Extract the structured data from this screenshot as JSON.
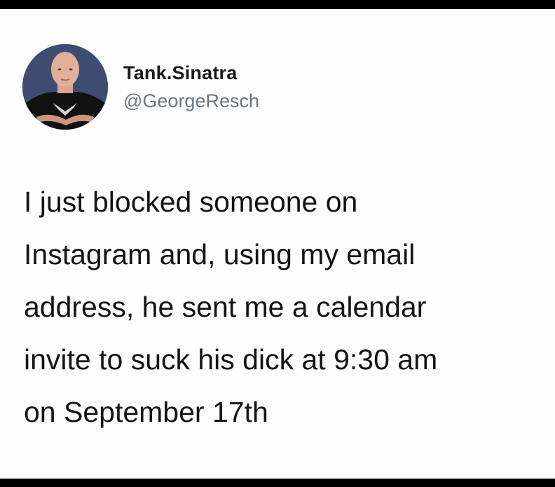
{
  "tweet": {
    "author": {
      "display_name": "Tank.Sinatra",
      "handle": "@GeorgeResch",
      "avatar_icon": "profile-photo"
    },
    "text_lines": [
      "I just blocked someone on",
      "Instagram and, using my email",
      "address, he sent me a calendar",
      "invite to suck his dick at 9:30 am",
      "on September 17th"
    ]
  },
  "colors": {
    "background": "#fdfdfd",
    "frame": "#000000",
    "name": "#1a1a1a",
    "handle": "#6b7680",
    "text": "#141414"
  }
}
